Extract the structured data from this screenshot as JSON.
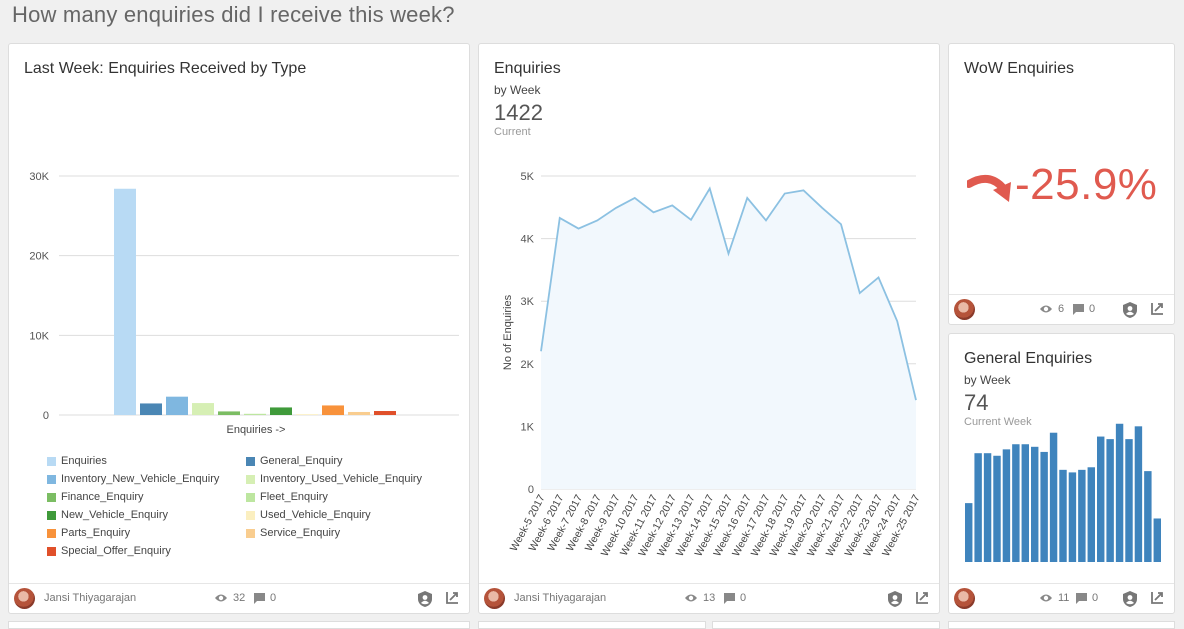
{
  "page": {
    "title": "How many enquiries did I receive this week?"
  },
  "cards": {
    "types": {
      "title": "Last Week: Enquiries Received by Type",
      "footer": {
        "author": "Jansi Thiyagarajan",
        "views": "32",
        "comments": "0"
      }
    },
    "enquiries": {
      "title": "Enquiries",
      "subtitle": "by Week",
      "value": "1422",
      "value_caption": "Current",
      "footer": {
        "author": "Jansi Thiyagarajan",
        "views": "13",
        "comments": "0"
      }
    },
    "wow": {
      "title": "WoW Enquiries",
      "value": "-25.9%",
      "trend_color": "#e05a4f",
      "trend_icon": "curved-arrow-down-icon",
      "footer": {
        "views": "6",
        "comments": "0"
      }
    },
    "general": {
      "title": "General Enquiries",
      "subtitle": "by Week",
      "value": "74",
      "value_caption": "Current Week",
      "footer": {
        "views": "11",
        "comments": "0"
      }
    }
  },
  "icons": {
    "views": "eye-icon",
    "comments": "comment-icon",
    "certified": "shield-user-icon",
    "expand": "expand-icon"
  },
  "chart_data": [
    {
      "type": "bar",
      "title": "Last Week: Enquiries Received by Type",
      "xlabel": "Enquiries ->",
      "ylabel": "",
      "ylim": [
        0,
        30000
      ],
      "y_ticks": [
        0,
        10000,
        20000,
        30000
      ],
      "y_tick_labels": [
        "0",
        "10K",
        "20K",
        "30K"
      ],
      "grid": true,
      "legend_position": "bottom",
      "series": [
        {
          "name": "Enquiries",
          "color": "#b8daf4",
          "value": 28400
        },
        {
          "name": "General_Enquiry",
          "color": "#4a86b4",
          "value": 1450
        },
        {
          "name": "Inventory_New_Vehicle_Enquiry",
          "color": "#7fb7e0",
          "value": 2300
        },
        {
          "name": "Inventory_Used_Vehicle_Enquiry",
          "color": "#d6efb4",
          "value": 1500
        },
        {
          "name": "Finance_Enquiry",
          "color": "#7bbd63",
          "value": 450
        },
        {
          "name": "Fleet_Enquiry",
          "color": "#bde6a0",
          "value": 150
        },
        {
          "name": "New_Vehicle_Enquiry",
          "color": "#3f9a3a",
          "value": 950
        },
        {
          "name": "Used_Vehicle_Enquiry",
          "color": "#fbefc0",
          "value": 100
        },
        {
          "name": "Parts_Enquiry",
          "color": "#f8923b",
          "value": 1200
        },
        {
          "name": "Service_Enquiry",
          "color": "#f9cd8f",
          "value": 380
        },
        {
          "name": "Special_Offer_Enquiry",
          "color": "#e0502a",
          "value": 500
        }
      ]
    },
    {
      "type": "area",
      "title": "Enquiries",
      "subtitle": "by Week",
      "xlabel": "",
      "ylabel": "No of Enquiries",
      "ylim": [
        0,
        5000
      ],
      "y_ticks": [
        0,
        1000,
        2000,
        3000,
        4000,
        5000
      ],
      "y_tick_labels": [
        "0",
        "1K",
        "2K",
        "3K",
        "4K",
        "5K"
      ],
      "grid": true,
      "line_color": "#8cc1e2",
      "fill_color": "#f2f8fd",
      "x": [
        "Week-5 2017",
        "Week-6 2017",
        "Week-7 2017",
        "Week-8 2017",
        "Week-9 2017",
        "Week-10 2017",
        "Week-11 2017",
        "Week-12 2017",
        "Week-13 2017",
        "Week-14 2017",
        "Week-15 2017",
        "Week-16 2017",
        "Week-17 2017",
        "Week-18 2017",
        "Week-19 2017",
        "Week-20 2017",
        "Week-21 2017",
        "Week-22 2017",
        "Week-23 2017",
        "Week-24 2017",
        "Week-25 2017"
      ],
      "values": [
        2200,
        4330,
        4160,
        4290,
        4490,
        4650,
        4420,
        4530,
        4300,
        4800,
        3760,
        4650,
        4290,
        4720,
        4770,
        4490,
        4230,
        3130,
        3380,
        2680,
        1420
      ]
    },
    {
      "type": "bar",
      "title": "General Enquiries",
      "subtitle": "by Week",
      "grid": false,
      "color": "#3f84bd",
      "ylim": [
        0,
        1000
      ],
      "values": [
        460,
        850,
        850,
        830,
        880,
        920,
        920,
        900,
        860,
        1010,
        720,
        700,
        720,
        740,
        980,
        960,
        1080,
        960,
        1060,
        710,
        340
      ]
    }
  ]
}
